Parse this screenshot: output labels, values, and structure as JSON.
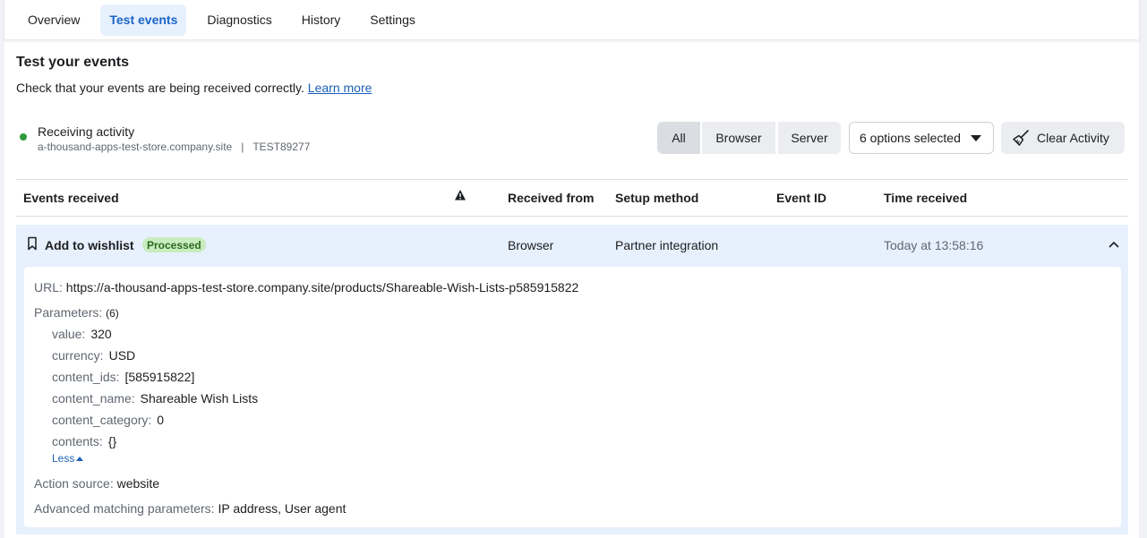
{
  "tabs": {
    "overview": "Overview",
    "test_events": "Test events",
    "diagnostics": "Diagnostics",
    "history": "History",
    "settings": "Settings"
  },
  "header": {
    "title": "Test your events",
    "description": "Check that your events are being received correctly.",
    "learn_more": "Learn more"
  },
  "activity": {
    "status": "Receiving activity",
    "site": "a-thousand-apps-test-store.company.site",
    "separator": "|",
    "test_code": "TEST89277",
    "status_color": "#2f9a3c"
  },
  "filters": {
    "all": "All",
    "browser": "Browser",
    "server": "Server",
    "options": "6 options selected",
    "clear": "Clear Activity"
  },
  "table": {
    "columns": {
      "events": "Events received",
      "received_from": "Received from",
      "setup_method": "Setup method",
      "event_id": "Event ID",
      "time_received": "Time received"
    },
    "row": {
      "name": "Add to wishlist",
      "badge": "Processed",
      "received_from": "Browser",
      "setup_method": "Partner integration",
      "event_id": "",
      "time": "Today at 13:58:16"
    }
  },
  "details": {
    "url_label": "URL:",
    "url": "https://a-thousand-apps-test-store.company.site/products/Shareable-Wish-Lists-p585915822",
    "params_label": "Parameters:",
    "params_count": "(6)",
    "params": [
      {
        "key": "value:",
        "val": "320"
      },
      {
        "key": "currency:",
        "val": "USD"
      },
      {
        "key": "content_ids:",
        "val": "[585915822]"
      },
      {
        "key": "content_name:",
        "val": "Shareable Wish Lists"
      },
      {
        "key": "content_category:",
        "val": "0"
      },
      {
        "key": "contents:",
        "val": "{}"
      }
    ],
    "less": "Less",
    "action_source_label": "Action source:",
    "action_source": "website",
    "amp_label": "Advanced matching parameters:",
    "amp": "IP address, User agent"
  },
  "colors": {
    "accent": "#1b66c9",
    "row_bg": "#e7f0fd",
    "badge_bg": "#c8ecbf"
  }
}
